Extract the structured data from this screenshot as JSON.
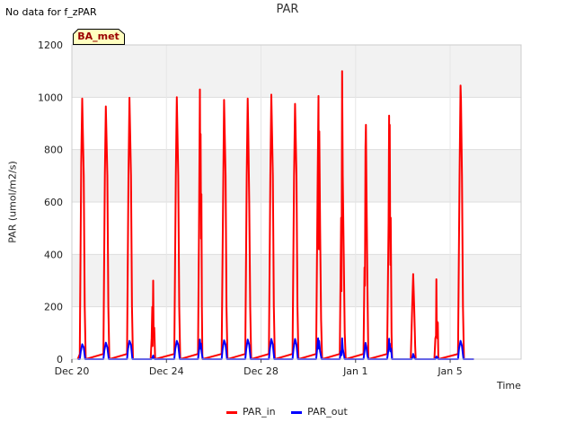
{
  "header": {
    "no_data_text": "No data for f_zPAR",
    "badge_text": "BA_met"
  },
  "chart_data": {
    "type": "line",
    "title": "PAR",
    "xlabel": "Time",
    "ylabel": "PAR (umol/m2/s)",
    "ylim": [
      0,
      1200
    ],
    "yticks": [
      0,
      200,
      400,
      600,
      800,
      1000,
      1200
    ],
    "xlim": [
      "2023-12-20",
      "2024-01-08"
    ],
    "xticks": [
      {
        "date": "2023-12-20",
        "label": "Dec 20"
      },
      {
        "date": "2023-12-24",
        "label": "Dec 24"
      },
      {
        "date": "2023-12-28",
        "label": "Dec 28"
      },
      {
        "date": "2024-01-01",
        "label": "Jan 1"
      },
      {
        "date": "2024-01-05",
        "label": "Jan 5"
      }
    ],
    "grid": true,
    "legend_position": "bottom",
    "series": [
      {
        "name": "PAR_in",
        "color": "#ff0000",
        "points": [
          [
            "2023-12-20T06:00",
            0
          ],
          [
            "2023-12-20T08:00",
            20
          ],
          [
            "2023-12-20T09:30",
            750
          ],
          [
            "2023-12-20T10:30",
            995
          ],
          [
            "2023-12-20T12:00",
            700
          ],
          [
            "2023-12-20T13:00",
            200
          ],
          [
            "2023-12-20T14:00",
            0
          ],
          [
            "2023-12-21T08:00",
            20
          ],
          [
            "2023-12-21T09:30",
            700
          ],
          [
            "2023-12-21T10:30",
            965
          ],
          [
            "2023-12-21T12:00",
            700
          ],
          [
            "2023-12-21T13:00",
            200
          ],
          [
            "2023-12-21T14:00",
            0
          ],
          [
            "2023-12-22T08:00",
            20
          ],
          [
            "2023-12-22T09:30",
            700
          ],
          [
            "2023-12-22T10:30",
            998
          ],
          [
            "2023-12-22T12:00",
            700
          ],
          [
            "2023-12-22T13:00",
            200
          ],
          [
            "2023-12-22T14:00",
            0
          ],
          [
            "2023-12-23T08:00",
            0
          ],
          [
            "2023-12-23T09:00",
            80
          ],
          [
            "2023-12-23T09:40",
            200
          ],
          [
            "2023-12-23T10:00",
            50
          ],
          [
            "2023-12-23T10:30",
            300
          ],
          [
            "2023-12-23T11:00",
            90
          ],
          [
            "2023-12-23T11:40",
            120
          ],
          [
            "2023-12-23T12:30",
            0
          ],
          [
            "2023-12-24T08:00",
            20
          ],
          [
            "2023-12-24T09:30",
            700
          ],
          [
            "2023-12-24T10:30",
            1000
          ],
          [
            "2023-12-24T12:00",
            700
          ],
          [
            "2023-12-24T13:00",
            200
          ],
          [
            "2023-12-24T14:00",
            0
          ],
          [
            "2023-12-25T08:00",
            20
          ],
          [
            "2023-12-25T09:00",
            450
          ],
          [
            "2023-12-25T10:00",
            1030
          ],
          [
            "2023-12-25T10:20",
            700
          ],
          [
            "2023-12-25T10:40",
            860
          ],
          [
            "2023-12-25T11:10",
            460
          ],
          [
            "2023-12-25T11:30",
            630
          ],
          [
            "2023-12-25T12:00",
            200
          ],
          [
            "2023-12-25T12:30",
            0
          ],
          [
            "2023-12-26T08:00",
            20
          ],
          [
            "2023-12-26T09:30",
            600
          ],
          [
            "2023-12-26T10:30",
            990
          ],
          [
            "2023-12-26T12:00",
            700
          ],
          [
            "2023-12-26T13:00",
            200
          ],
          [
            "2023-12-26T14:00",
            0
          ],
          [
            "2023-12-27T08:00",
            20
          ],
          [
            "2023-12-27T09:30",
            700
          ],
          [
            "2023-12-27T10:30",
            995
          ],
          [
            "2023-12-27T11:00",
            880
          ],
          [
            "2023-12-27T12:00",
            600
          ],
          [
            "2023-12-27T13:00",
            200
          ],
          [
            "2023-12-27T14:00",
            0
          ],
          [
            "2023-12-28T08:00",
            20
          ],
          [
            "2023-12-28T09:30",
            700
          ],
          [
            "2023-12-28T10:30",
            1010
          ],
          [
            "2023-12-28T12:00",
            700
          ],
          [
            "2023-12-28T13:00",
            200
          ],
          [
            "2023-12-28T14:00",
            0
          ],
          [
            "2023-12-29T08:00",
            20
          ],
          [
            "2023-12-29T09:30",
            700
          ],
          [
            "2023-12-29T10:30",
            975
          ],
          [
            "2023-12-29T12:00",
            700
          ],
          [
            "2023-12-29T13:00",
            200
          ],
          [
            "2023-12-29T14:00",
            0
          ],
          [
            "2023-12-30T08:00",
            20
          ],
          [
            "2023-12-30T09:30",
            700
          ],
          [
            "2023-12-30T10:20",
            1005
          ],
          [
            "2023-12-30T10:40",
            420
          ],
          [
            "2023-12-30T11:10",
            870
          ],
          [
            "2023-12-30T12:00",
            500
          ],
          [
            "2023-12-30T13:00",
            150
          ],
          [
            "2023-12-30T14:00",
            0
          ],
          [
            "2023-12-31T08:00",
            20
          ],
          [
            "2023-12-31T09:20",
            540
          ],
          [
            "2023-12-31T09:40",
            260
          ],
          [
            "2023-12-31T10:20",
            1100
          ],
          [
            "2023-12-31T11:00",
            700
          ],
          [
            "2023-12-31T12:00",
            400
          ],
          [
            "2023-12-31T13:00",
            100
          ],
          [
            "2023-12-31T14:00",
            0
          ],
          [
            "2024-01-01T08:00",
            20
          ],
          [
            "2024-01-01T09:00",
            350
          ],
          [
            "2024-01-01T09:30",
            280
          ],
          [
            "2024-01-01T10:00",
            810
          ],
          [
            "2024-01-01T10:30",
            895
          ],
          [
            "2024-01-01T11:00",
            650
          ],
          [
            "2024-01-01T12:00",
            300
          ],
          [
            "2024-01-01T13:00",
            0
          ],
          [
            "2024-01-02T08:00",
            20
          ],
          [
            "2024-01-02T09:30",
            520
          ],
          [
            "2024-01-02T10:00",
            930
          ],
          [
            "2024-01-02T10:20",
            560
          ],
          [
            "2024-01-02T10:40",
            895
          ],
          [
            "2024-01-02T11:00",
            540
          ],
          [
            "2024-01-02T11:20",
            360
          ],
          [
            "2024-01-02T11:40",
            540
          ],
          [
            "2024-01-02T12:30",
            100
          ],
          [
            "2024-01-02T13:00",
            0
          ],
          [
            "2024-01-03T08:00",
            0
          ],
          [
            "2024-01-03T09:30",
            200
          ],
          [
            "2024-01-03T10:30",
            325
          ],
          [
            "2024-01-03T11:30",
            200
          ],
          [
            "2024-01-03T12:30",
            50
          ],
          [
            "2024-01-03T13:00",
            0
          ],
          [
            "2024-01-04T08:00",
            0
          ],
          [
            "2024-01-04T09:00",
            80
          ],
          [
            "2024-01-04T09:40",
            90
          ],
          [
            "2024-01-04T10:00",
            305
          ],
          [
            "2024-01-04T10:20",
            120
          ],
          [
            "2024-01-04T10:40",
            145
          ],
          [
            "2024-01-04T11:00",
            80
          ],
          [
            "2024-01-04T11:30",
            140
          ],
          [
            "2024-01-04T12:00",
            0
          ],
          [
            "2024-01-05T08:00",
            20
          ],
          [
            "2024-01-05T09:30",
            700
          ],
          [
            "2024-01-05T10:30",
            1045
          ],
          [
            "2024-01-05T11:00",
            990
          ],
          [
            "2024-01-05T12:00",
            700
          ],
          [
            "2024-01-05T13:00",
            200
          ],
          [
            "2024-01-05T14:00",
            0
          ],
          [
            "2024-01-06T00:00",
            0
          ]
        ]
      },
      {
        "name": "PAR_out",
        "color": "#0000ff",
        "points": [
          [
            "2023-12-20T06:00",
            0
          ],
          [
            "2023-12-20T08:00",
            0
          ],
          [
            "2023-12-20T09:00",
            30
          ],
          [
            "2023-12-20T10:30",
            57
          ],
          [
            "2023-12-20T12:00",
            45
          ],
          [
            "2023-12-20T13:30",
            0
          ],
          [
            "2023-12-21T08:00",
            0
          ],
          [
            "2023-12-21T09:00",
            35
          ],
          [
            "2023-12-21T10:30",
            63
          ],
          [
            "2023-12-21T12:00",
            45
          ],
          [
            "2023-12-21T13:30",
            0
          ],
          [
            "2023-12-22T08:00",
            0
          ],
          [
            "2023-12-22T09:00",
            40
          ],
          [
            "2023-12-22T10:30",
            70
          ],
          [
            "2023-12-22T12:00",
            55
          ],
          [
            "2023-12-22T13:30",
            0
          ],
          [
            "2023-12-23T09:00",
            0
          ],
          [
            "2023-12-23T10:00",
            8
          ],
          [
            "2023-12-23T10:30",
            14
          ],
          [
            "2023-12-23T11:00",
            4
          ],
          [
            "2023-12-23T12:00",
            0
          ],
          [
            "2023-12-24T08:00",
            0
          ],
          [
            "2023-12-24T09:00",
            40
          ],
          [
            "2023-12-24T10:30",
            70
          ],
          [
            "2023-12-24T12:00",
            55
          ],
          [
            "2023-12-24T13:30",
            0
          ],
          [
            "2023-12-25T08:00",
            0
          ],
          [
            "2023-12-25T09:00",
            30
          ],
          [
            "2023-12-25T10:00",
            75
          ],
          [
            "2023-12-25T10:30",
            40
          ],
          [
            "2023-12-25T11:00",
            60
          ],
          [
            "2023-12-25T12:00",
            20
          ],
          [
            "2023-12-25T13:00",
            0
          ],
          [
            "2023-12-26T08:00",
            0
          ],
          [
            "2023-12-26T09:00",
            40
          ],
          [
            "2023-12-26T10:30",
            72
          ],
          [
            "2023-12-26T12:00",
            55
          ],
          [
            "2023-12-26T13:30",
            0
          ],
          [
            "2023-12-27T08:00",
            0
          ],
          [
            "2023-12-27T09:00",
            40
          ],
          [
            "2023-12-27T10:30",
            75
          ],
          [
            "2023-12-27T12:00",
            55
          ],
          [
            "2023-12-27T13:30",
            0
          ],
          [
            "2023-12-28T08:00",
            0
          ],
          [
            "2023-12-28T09:00",
            40
          ],
          [
            "2023-12-28T10:30",
            77
          ],
          [
            "2023-12-28T12:00",
            55
          ],
          [
            "2023-12-28T13:30",
            0
          ],
          [
            "2023-12-29T08:00",
            0
          ],
          [
            "2023-12-29T09:00",
            40
          ],
          [
            "2023-12-29T10:30",
            77
          ],
          [
            "2023-12-29T12:00",
            55
          ],
          [
            "2023-12-29T13:30",
            0
          ],
          [
            "2023-12-30T08:00",
            0
          ],
          [
            "2023-12-30T09:00",
            40
          ],
          [
            "2023-12-30T10:00",
            80
          ],
          [
            "2023-12-30T10:30",
            40
          ],
          [
            "2023-12-30T11:00",
            70
          ],
          [
            "2023-12-30T12:00",
            30
          ],
          [
            "2023-12-30T13:30",
            0
          ],
          [
            "2023-12-31T08:00",
            0
          ],
          [
            "2023-12-31T09:00",
            30
          ],
          [
            "2023-12-31T09:40",
            15
          ],
          [
            "2023-12-31T10:20",
            80
          ],
          [
            "2023-12-31T11:00",
            40
          ],
          [
            "2023-12-31T12:00",
            20
          ],
          [
            "2023-12-31T13:00",
            0
          ],
          [
            "2024-01-01T08:00",
            0
          ],
          [
            "2024-01-01T09:00",
            30
          ],
          [
            "2024-01-01T10:00",
            62
          ],
          [
            "2024-01-01T11:00",
            45
          ],
          [
            "2024-01-01T12:00",
            15
          ],
          [
            "2024-01-01T13:00",
            0
          ],
          [
            "2024-01-02T08:00",
            0
          ],
          [
            "2024-01-02T09:30",
            40
          ],
          [
            "2024-01-02T10:00",
            78
          ],
          [
            "2024-01-02T10:20",
            40
          ],
          [
            "2024-01-02T10:40",
            60
          ],
          [
            "2024-01-02T11:20",
            30
          ],
          [
            "2024-01-02T12:00",
            40
          ],
          [
            "2024-01-02T13:00",
            0
          ],
          [
            "2024-01-03T09:00",
            0
          ],
          [
            "2024-01-03T10:00",
            12
          ],
          [
            "2024-01-03T10:30",
            20
          ],
          [
            "2024-01-03T11:30",
            8
          ],
          [
            "2024-01-03T12:30",
            0
          ],
          [
            "2024-01-04T09:00",
            0
          ],
          [
            "2024-01-04T10:00",
            10
          ],
          [
            "2024-01-04T10:30",
            6
          ],
          [
            "2024-01-04T11:00",
            8
          ],
          [
            "2024-01-04T12:00",
            0
          ],
          [
            "2024-01-05T08:00",
            0
          ],
          [
            "2024-01-05T09:00",
            40
          ],
          [
            "2024-01-05T10:30",
            70
          ],
          [
            "2024-01-05T12:00",
            50
          ],
          [
            "2024-01-05T13:30",
            0
          ],
          [
            "2024-01-06T00:00",
            0
          ]
        ]
      }
    ]
  }
}
